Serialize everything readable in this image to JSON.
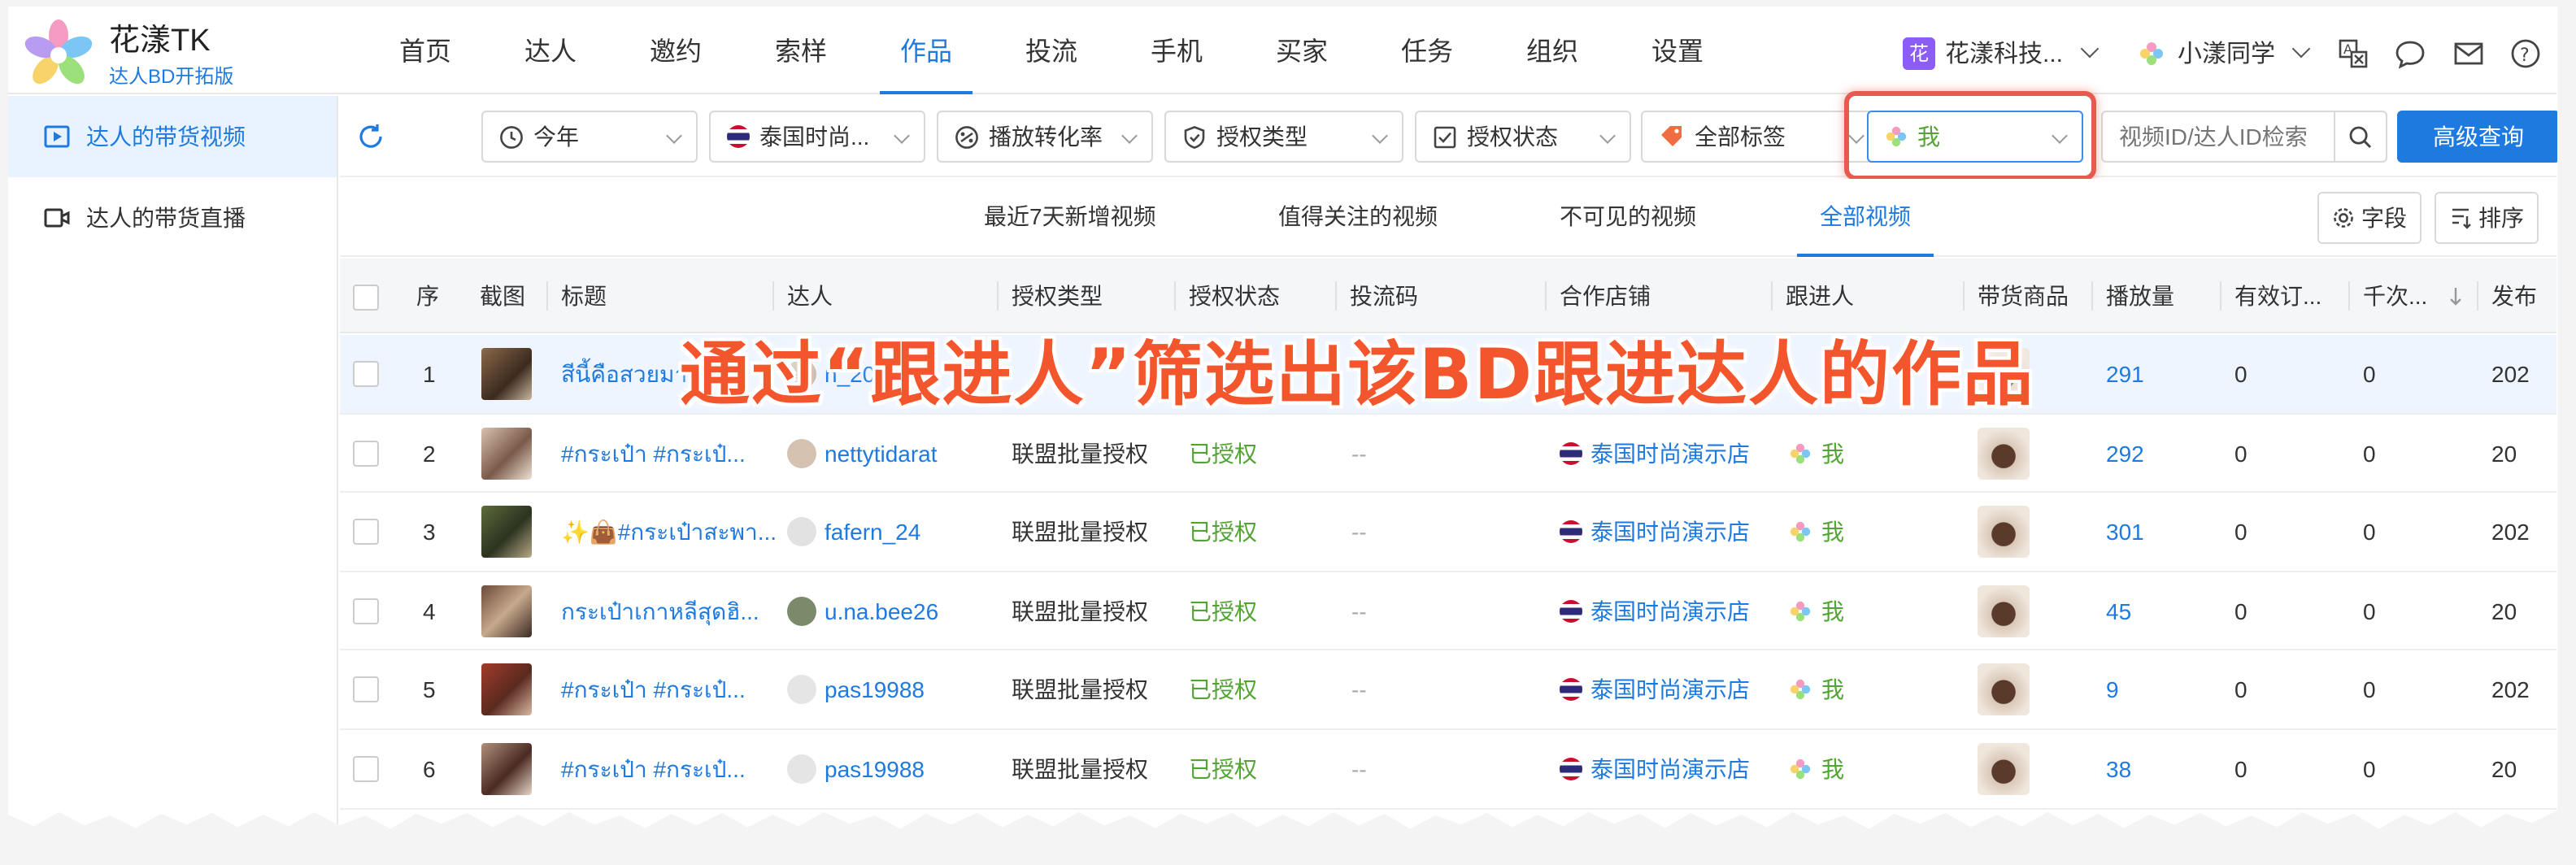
{
  "brand": {
    "name": "花漾TK",
    "subtitle": "达人BD开拓版"
  },
  "nav": [
    "首页",
    "达人",
    "邀约",
    "索样",
    "作品",
    "投流",
    "手机",
    "买家",
    "任务",
    "组织",
    "设置"
  ],
  "nav_active": "作品",
  "header": {
    "org_badge": "花",
    "org_name": "花漾科技...",
    "user_name": "小漾同学"
  },
  "sidebar": [
    {
      "label": "达人的带货视频",
      "active": true
    },
    {
      "label": "达人的带货直播",
      "active": false
    }
  ],
  "filters": {
    "time": "今年",
    "shop": "泰国时尚...",
    "metric": "播放转化率",
    "auth_type": "授权类型",
    "auth_status": "授权状态",
    "tags": "全部标签",
    "follower": "我",
    "search_placeholder": "视频ID/达人ID检索",
    "advanced": "高级查询"
  },
  "subtabs": [
    "最近7天新增视频",
    "值得关注的视频",
    "不可见的视频",
    "全部视频"
  ],
  "subtab_active": "全部视频",
  "tools": {
    "fields": "字段",
    "sort": "排序"
  },
  "columns": [
    "序",
    "截图",
    "标题",
    "达人",
    "授权类型",
    "授权状态",
    "投流码",
    "合作店铺",
    "跟进人",
    "带货商品",
    "播放量",
    "有效订...",
    "千次...",
    "发布"
  ],
  "rows": [
    {
      "no": "1",
      "title": "สีนี้คือสวยมาก",
      "creator": "n_200",
      "auth_type": "",
      "auth_status": "",
      "code": "",
      "shop": "",
      "follower": "",
      "plays": "291",
      "orders": "0",
      "cpm": "0",
      "pub": "202"
    },
    {
      "no": "2",
      "title": "#กระเป๋า #กระเป๋...",
      "creator": "nettytidarat",
      "auth_type": "联盟批量授权",
      "auth_status": "已授权",
      "code": "--",
      "shop": "泰国时尚演示店",
      "follower": "我",
      "plays": "292",
      "orders": "0",
      "cpm": "0",
      "pub": "20"
    },
    {
      "no": "3",
      "title": "✨👜#กระเป๋าสะพา...",
      "creator": "fafern_24",
      "auth_type": "联盟批量授权",
      "auth_status": "已授权",
      "code": "--",
      "shop": "泰国时尚演示店",
      "follower": "我",
      "plays": "301",
      "orders": "0",
      "cpm": "0",
      "pub": "202"
    },
    {
      "no": "4",
      "title": "กระเป๋าเกาหลีสุดฮิ...",
      "creator": "u.na.bee26",
      "auth_type": "联盟批量授权",
      "auth_status": "已授权",
      "code": "--",
      "shop": "泰国时尚演示店",
      "follower": "我",
      "plays": "45",
      "orders": "0",
      "cpm": "0",
      "pub": "20"
    },
    {
      "no": "5",
      "title": "#กระเป๋า #กระเป๋...",
      "creator": "pas19988",
      "auth_type": "联盟批量授权",
      "auth_status": "已授权",
      "code": "--",
      "shop": "泰国时尚演示店",
      "follower": "我",
      "plays": "9",
      "orders": "0",
      "cpm": "0",
      "pub": "202"
    },
    {
      "no": "6",
      "title": "#กระเป๋า #กระเป๋...",
      "creator": "pas19988",
      "auth_type": "联盟批量授权",
      "auth_status": "已授权",
      "code": "--",
      "shop": "泰国时尚演示店",
      "follower": "我",
      "plays": "38",
      "orders": "0",
      "cpm": "0",
      "pub": "20"
    }
  ],
  "annotation": "通过“跟进人”筛选出该BD跟进达人的作品",
  "colors": {
    "accent": "#1f7ae0",
    "authorized": "#52a535",
    "annotation": "#f3552d",
    "highlight": "#e85a4f"
  }
}
